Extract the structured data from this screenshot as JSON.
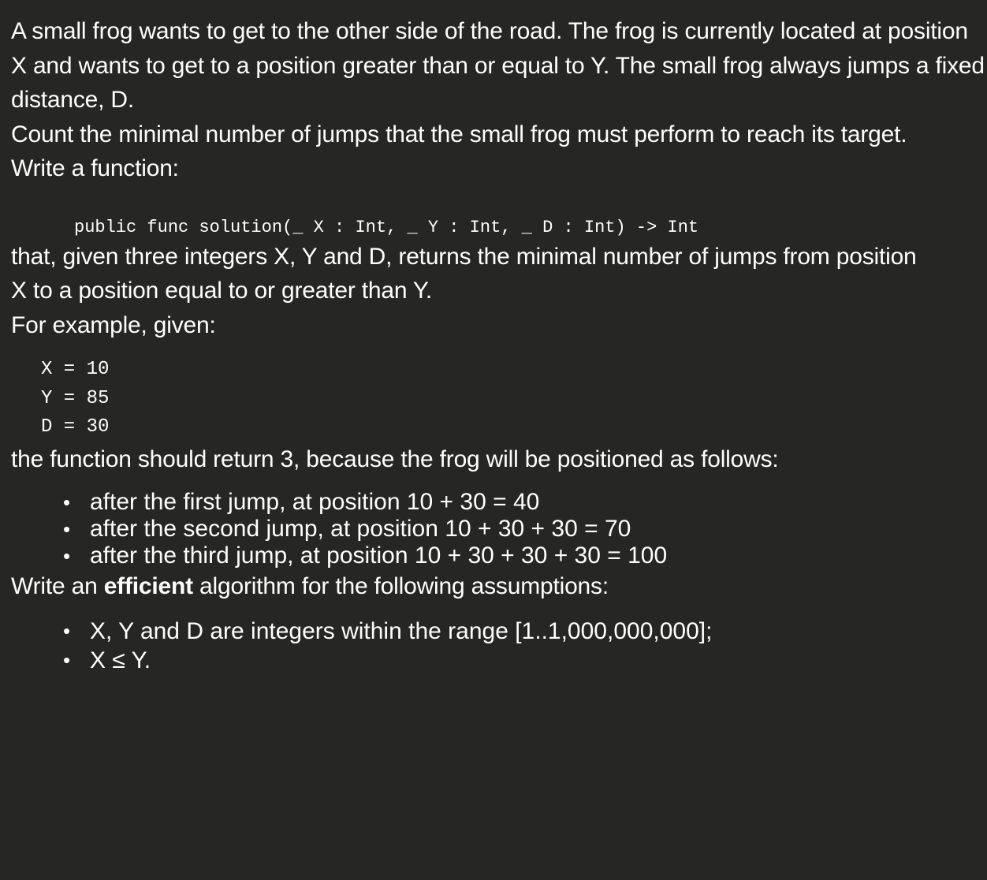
{
  "paragraphs": {
    "intro": "A small frog wants to get to the other side of the road. The frog is currently located at position X and wants to get to a position greater than or equal to Y. The small frog always jumps a fixed distance, D.",
    "task": "Count the minimal number of jumps that the small frog must perform to reach its target.",
    "write_function": "Write a function:",
    "signature": "public func solution(_ X : Int, _ Y : Int, _ D : Int) -> Int",
    "description_line1": "that, given three integers X, Y and D, returns the minimal number of jumps from position",
    "description_line2": "X to a position equal to or greater than Y.",
    "example_intro": "For example, given:",
    "example_code": "X = 10\nY = 85\nD = 30",
    "example_result": "the function should return 3, because the frog will be positioned as follows:",
    "assumptions_prefix": "Write an ",
    "assumptions_bold": "efficient",
    "assumptions_suffix": " algorithm for the following assumptions:"
  },
  "jumps": [
    "after the first jump, at position 10 + 30 = 40",
    "after the second jump, at position 10 + 30 + 30 = 70",
    "after the third jump, at position 10 + 30 + 30 + 30 = 100"
  ],
  "assumptions": [
    "X, Y and D are integers within the range [1..1,000,000,000];",
    "X ≤ Y."
  ],
  "bullet_glyph": "•",
  "colors": {
    "background": "#262624",
    "text": "#ffffff"
  }
}
